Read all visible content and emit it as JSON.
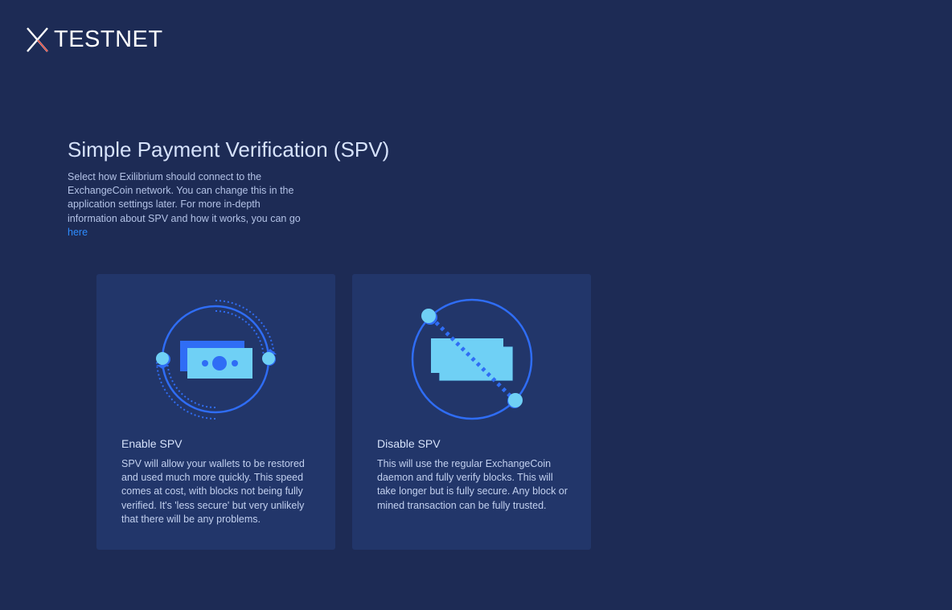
{
  "header": {
    "logo_text": "TESTNET",
    "logo_icon": "x-mark-logo"
  },
  "main": {
    "title": "Simple Payment Verification (SPV)",
    "description": "Select how Exilibrium should connect to the ExchangeCoin network. You can change this in the application settings later. For more in-depth information about SPV and how it works, you can go ",
    "link_text": "here"
  },
  "options": [
    {
      "title": "Enable SPV",
      "text": "SPV will allow your wallets to be restored and used much more quickly. This speed comes at cost, with blocks not being fully verified. It's 'less secure' but very unlikely that there will be any problems.",
      "icon": "spv-enabled-icon"
    },
    {
      "title": "Disable SPV",
      "text": "This will use the regular ExchangeCoin daemon and fully verify blocks. This will take longer but is fully secure. Any block or mined transaction can be fully trusted.",
      "icon": "spv-disabled-icon"
    }
  ],
  "colors": {
    "background": "#1d2b55",
    "card": "#22366a",
    "accent_blue": "#2f6df5",
    "light_blue": "#6fd0f5",
    "link": "#2d8cff"
  }
}
